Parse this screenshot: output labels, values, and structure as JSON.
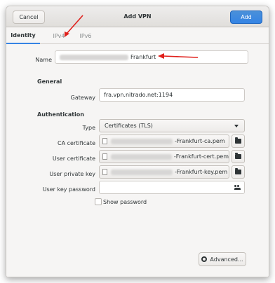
{
  "window": {
    "title": "Add VPN",
    "cancel_label": "Cancel",
    "add_label": "Add"
  },
  "tabs": [
    {
      "label": "Identity",
      "active": true
    },
    {
      "label": "IPv4",
      "active": false
    },
    {
      "label": "IPv6",
      "active": false
    }
  ],
  "identity": {
    "name_label": "Name",
    "name_value_suffix": "Frankfurt"
  },
  "general": {
    "section_label": "General",
    "gateway_label": "Gateway",
    "gateway_value": "fra.vpn.nitrado.net:1194"
  },
  "authentication": {
    "section_label": "Authentication",
    "type_label": "Type",
    "type_value": "Certificates (TLS)",
    "ca_label": "CA certificate",
    "ca_value_suffix": "-Frankfurt-ca.pem",
    "user_cert_label": "User certificate",
    "user_cert_value_suffix": "-Frankfurt-cert.pem",
    "user_key_label": "User private key",
    "user_key_value_suffix": "-Frankfurt-key.pem",
    "key_password_label": "User key password",
    "key_password_value": "",
    "show_password_label": "Show password"
  },
  "footer": {
    "advanced_label": "Advanced..."
  },
  "annotation": {
    "arrow_color": "#e0201b"
  },
  "colors": {
    "accent": "#3584e4"
  }
}
